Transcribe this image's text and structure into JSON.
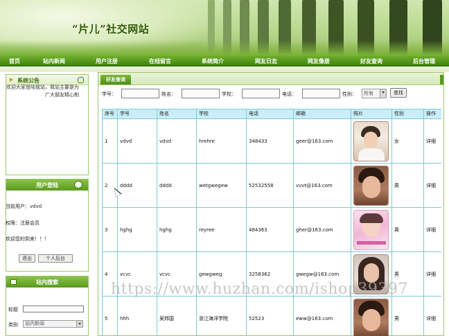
{
  "site": {
    "title": "“片儿”社交网站"
  },
  "nav": {
    "items": [
      "首页",
      "站内新闻",
      "用户注册",
      "在线留言",
      "系统简介",
      "网友日志",
      "网友像册",
      "好友查询",
      "后台管理"
    ]
  },
  "notice": {
    "title": "系统公告",
    "text": "欢迎大家登陆我站，我站主要是为广大朋友精心制"
  },
  "login": {
    "title": "用户登陆",
    "current_user_label": "当前用户：",
    "current_user": "vdvd",
    "role_label": "权限：",
    "role": "注册会员",
    "welcome": "欢迎您的到来！！！",
    "logout_button": "退出",
    "backend_button": "个人后台"
  },
  "site_search": {
    "title": "站内搜索",
    "title_label": "标题",
    "category_label": "类别",
    "category_value": "站内新闻"
  },
  "main": {
    "tab": "好友查询",
    "filters": {
      "student_id_label": "学号：",
      "name_label": "姓名：",
      "school_label": "学校：",
      "phone_label": "电话：",
      "gender_label": "性别：",
      "gender_value": "所有",
      "query_button": "查找"
    },
    "table": {
      "headers": [
        "序号",
        "学号",
        "姓名",
        "学校",
        "电话",
        "邮箱",
        "照片",
        "性别",
        "操作"
      ],
      "rows": [
        {
          "no": "1",
          "sid": "vdvd",
          "name": "vdvd",
          "school": "hrehre",
          "phone": "348433",
          "email": "geer@163.com",
          "gender": "女",
          "action": "详细"
        },
        {
          "no": "2",
          "sid": "dddd",
          "name": "dddd",
          "school": "wetgwegew",
          "phone": "52532558",
          "email": "vvvt@163.com",
          "gender": "男",
          "action": "详细"
        },
        {
          "no": "3",
          "sid": "hghg",
          "name": "hghg",
          "school": "reyree",
          "phone": "484363",
          "email": "gher@163.com",
          "gender": "男",
          "action": "详细"
        },
        {
          "no": "4",
          "sid": "vcvc",
          "name": "vcvc",
          "school": "gewgweg",
          "phone": "3258362",
          "email": "gwegw@163.com",
          "gender": "男",
          "action": "详细"
        },
        {
          "no": "5",
          "sid": "hhh",
          "name": "吴邦国",
          "school": "浙江海洋学院",
          "phone": "52523",
          "email": "eww@163.com",
          "gender": "男",
          "action": "详细"
        }
      ]
    }
  },
  "watermark": "https://www.huzhan.com/ishop39397"
}
